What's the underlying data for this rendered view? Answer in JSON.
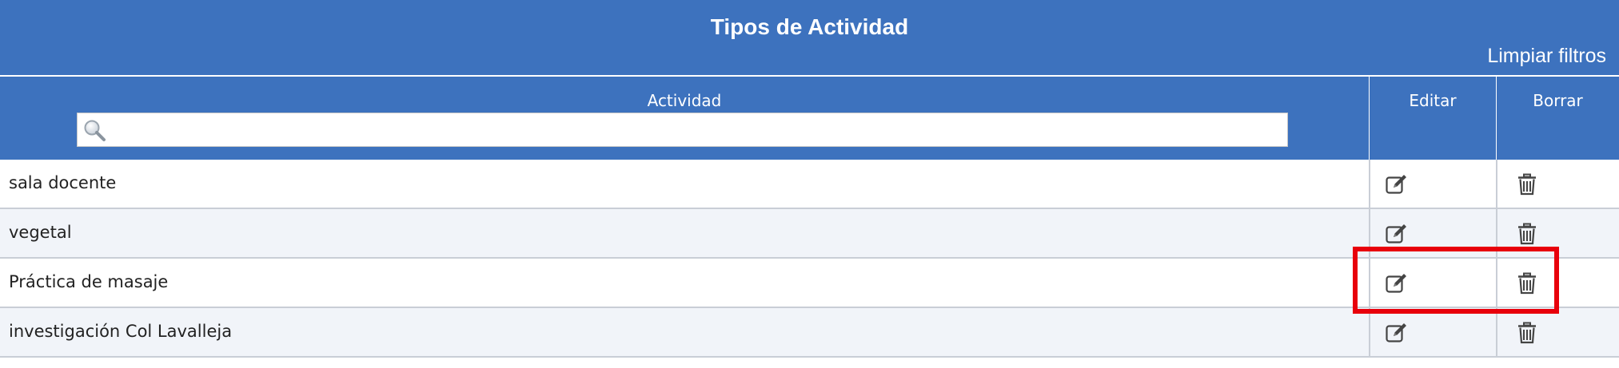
{
  "grid": {
    "title": "Tipos de Actividad",
    "clear_filters_label": "Limpiar filtros"
  },
  "columns": {
    "activity": "Actividad",
    "edit": "Editar",
    "delete": "Borrar"
  },
  "search": {
    "value": "",
    "placeholder": ""
  },
  "rows": [
    {
      "activity": "sala docente"
    },
    {
      "activity": "vegetal"
    },
    {
      "activity": "Práctica de masaje"
    },
    {
      "activity": "investigación Col Lavalleja"
    }
  ],
  "icons": {
    "search": "magnifier-icon",
    "edit": "edit-icon",
    "delete": "trash-icon"
  },
  "colors": {
    "header_bg": "#3d72be",
    "alt_row_bg": "#f1f4f9",
    "highlight": "#e8000b"
  }
}
